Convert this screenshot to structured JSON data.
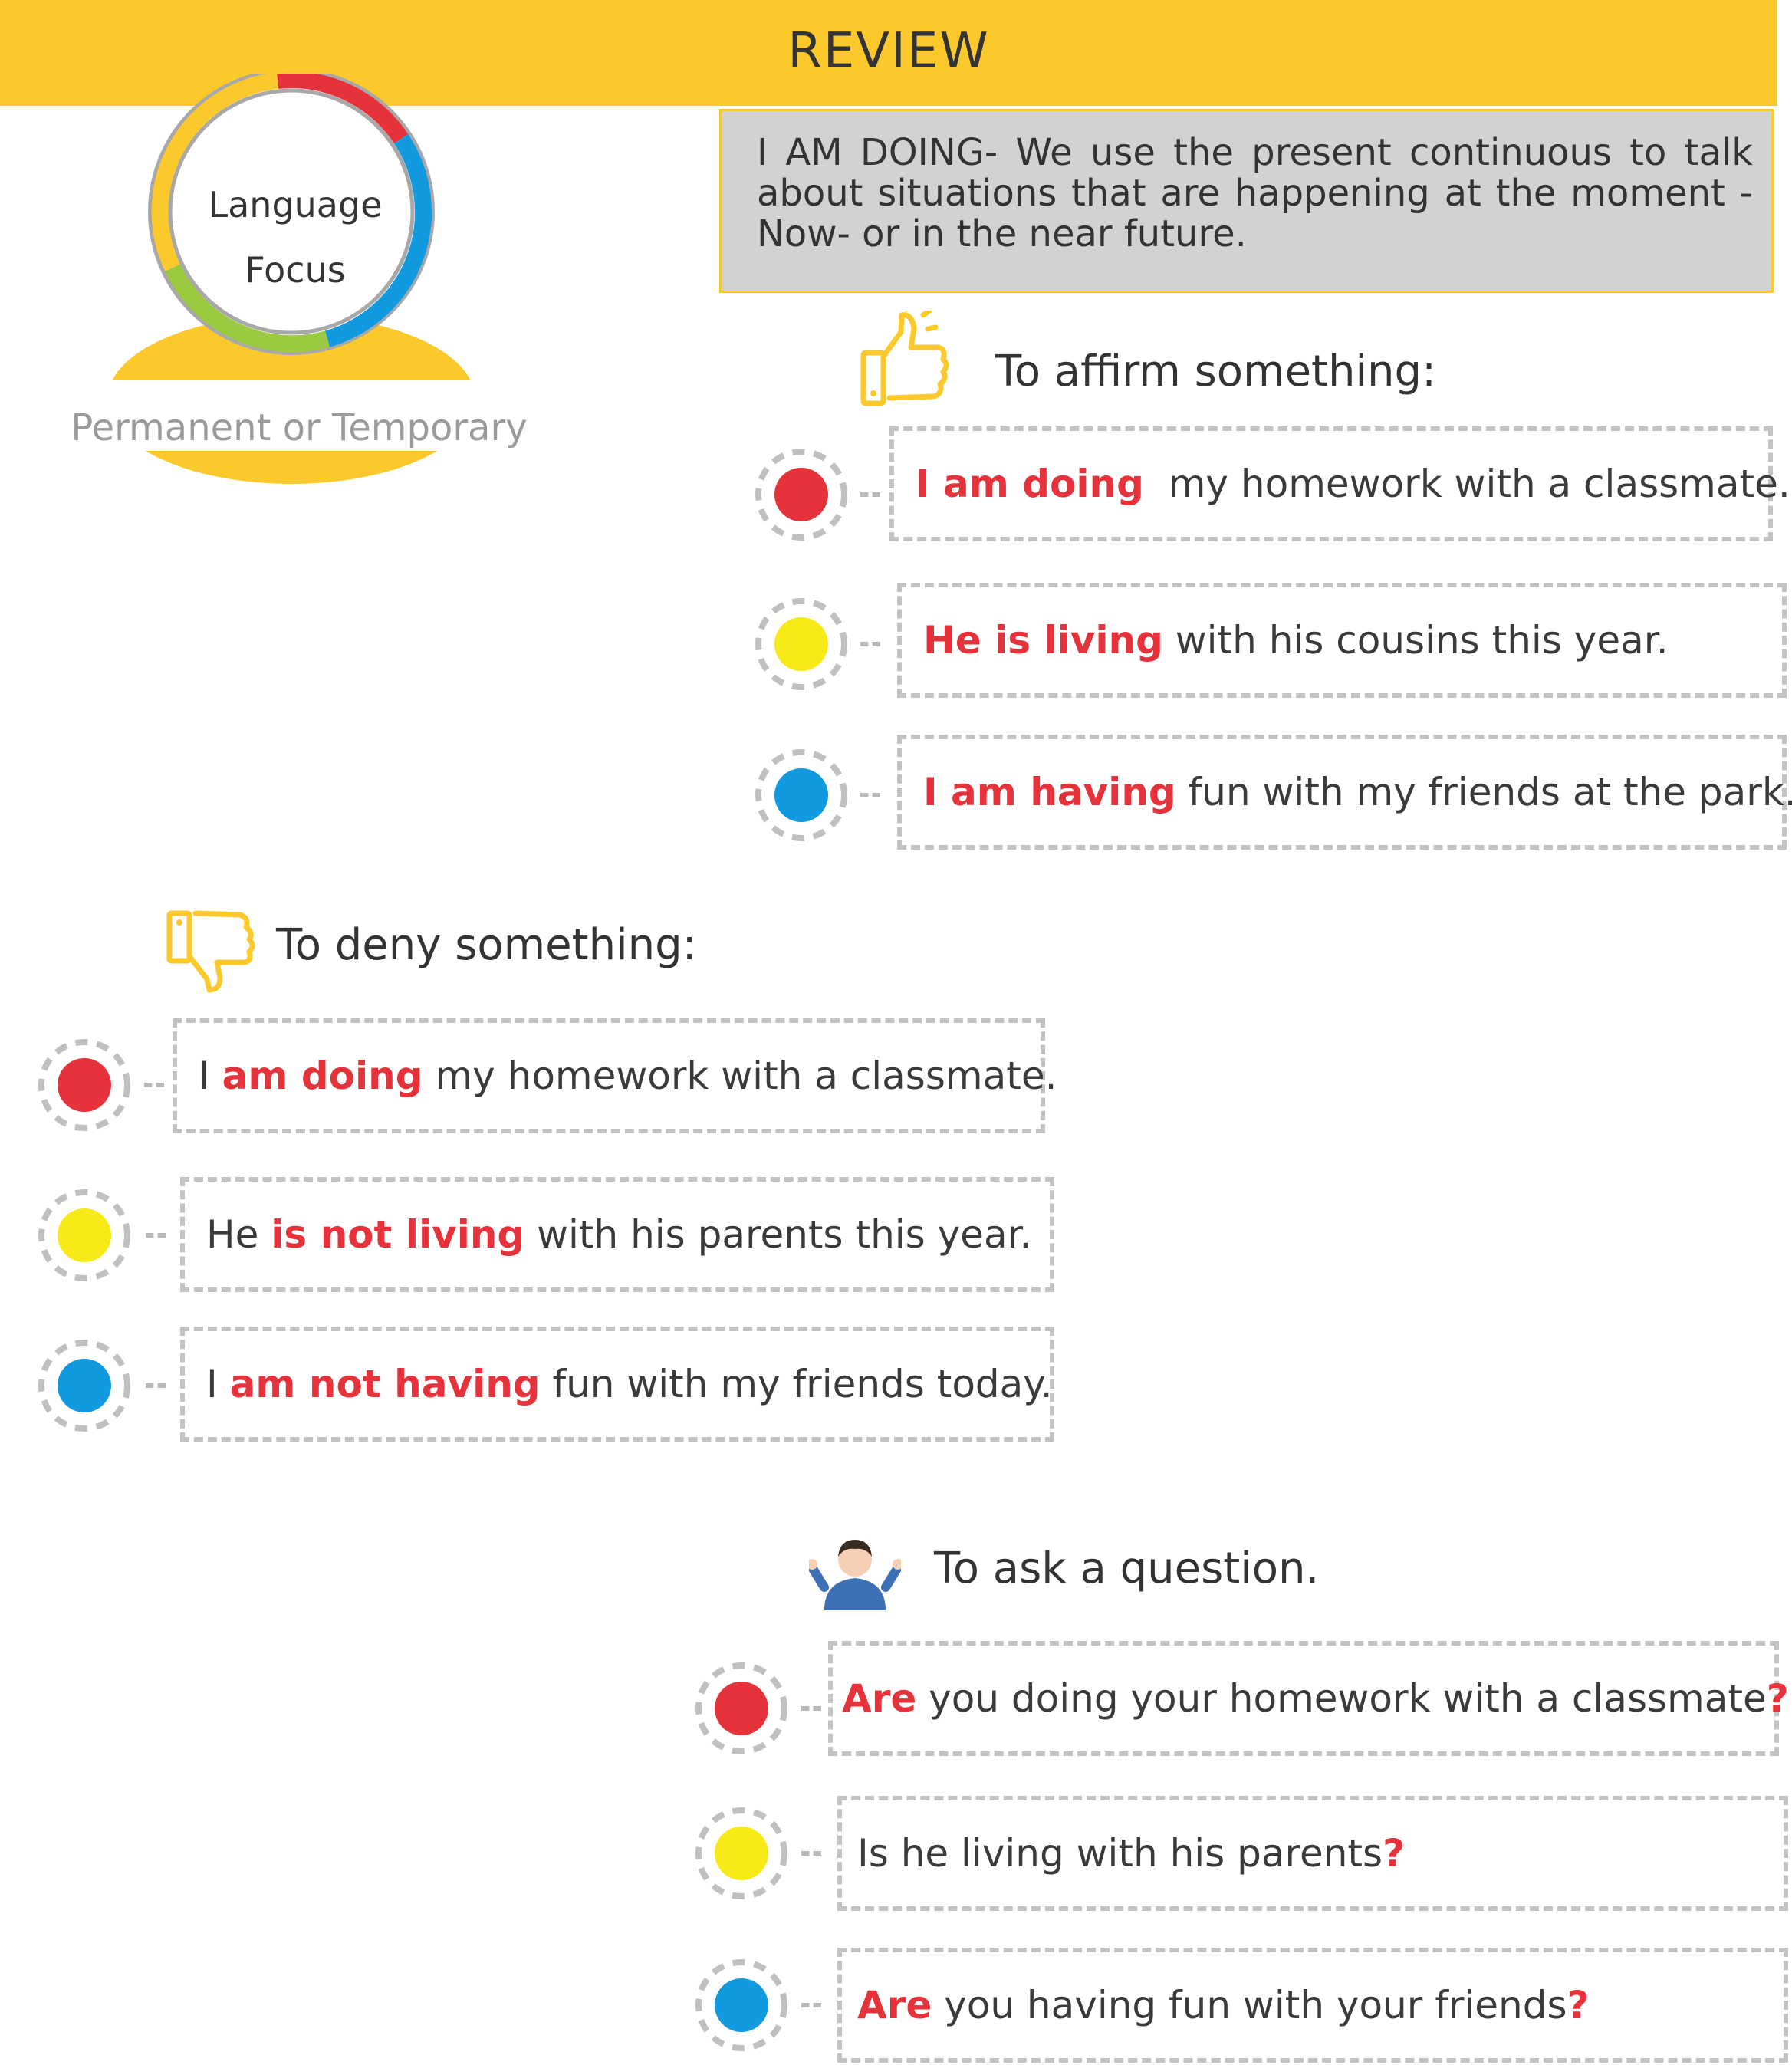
{
  "header": {
    "title": "REVIEW"
  },
  "focus": {
    "word1": "Language",
    "word2": "Focus",
    "subtitle": "Permanent or Temporary"
  },
  "definition": "I AM DOING- We use the present continuous to talk about situations that are happening at the moment -Now- or in the near future.",
  "colors": {
    "yellow_accent": "#fcc92c",
    "red": "#e5323b",
    "yellow": "#f8ea16",
    "blue": "#129ae0",
    "green": "#9bc93f",
    "gray_box": "#d1d2d4"
  },
  "sections": {
    "affirm": {
      "heading": "To affirm something:",
      "icon": "thumbs-up-icon",
      "rows": [
        {
          "dot": "red",
          "hl": "I am doing",
          "rest": "  my homework with a classmate."
        },
        {
          "dot": "yellow",
          "hl": "He is living",
          "rest": " with his cousins this year."
        },
        {
          "dot": "blue",
          "hl": "I am having",
          "rest": " fun with my friends at the park."
        }
      ]
    },
    "deny": {
      "heading": "To deny something:",
      "icon": "thumbs-down-icon",
      "rows": [
        {
          "dot": "red",
          "pre": "I ",
          "hl": "am doing",
          "rest": " my homework with a classmate."
        },
        {
          "dot": "yellow",
          "pre": "He ",
          "hl": "is not living",
          "rest": " with his parents this year."
        },
        {
          "dot": "blue",
          "pre": "I ",
          "hl": "am not having",
          "rest": " fun with my friends today."
        }
      ]
    },
    "question": {
      "heading": "To ask a question.",
      "icon": "person-shrugging-icon",
      "rows": [
        {
          "dot": "red",
          "hl": "Are",
          "rest": " you doing your homework with a classmate",
          "end": "?"
        },
        {
          "dot": "yellow",
          "pre": "Is he living with his parents",
          "end": "?"
        },
        {
          "dot": "blue",
          "hl": "Are",
          "rest": " you having fun with your friends",
          "end": "?"
        }
      ]
    }
  }
}
